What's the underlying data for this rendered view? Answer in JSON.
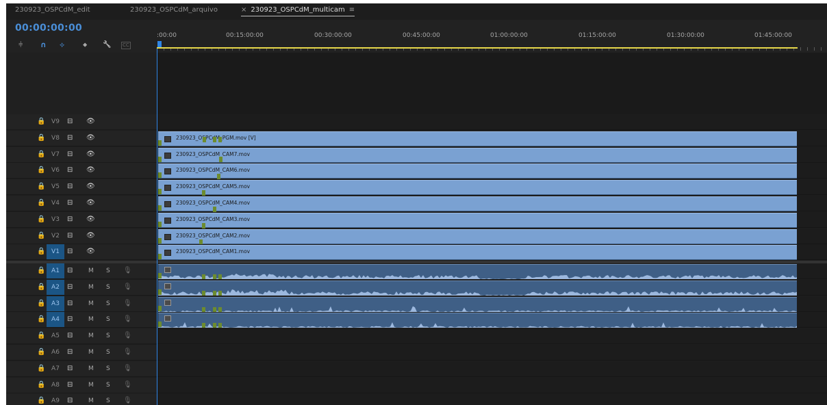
{
  "tabs": [
    {
      "label": "230923_OSPCdM_edit",
      "active": false
    },
    {
      "label": "230923_OSPCdM_arquivo",
      "active": false
    },
    {
      "label": "230923_OSPCdM_multicam",
      "active": true,
      "close_glyph": "×",
      "menu_glyph": "≡"
    }
  ],
  "timecode": "00:00:00:00",
  "tools": [
    {
      "name": "insert-nest-icon",
      "glyph": "⫩"
    },
    {
      "name": "snap-icon",
      "glyph": "∩"
    },
    {
      "name": "linked-selection-icon",
      "glyph": "⟡"
    },
    {
      "name": "add-marker-icon",
      "glyph": "⬥"
    },
    {
      "name": "wrench-icon",
      "glyph": "🔧"
    },
    {
      "name": "captions-icon",
      "glyph": "CC"
    }
  ],
  "ruler_ticks": [
    ":00:00",
    "00:15:00:00",
    "00:30:00:00",
    "00:45:00:00",
    "01:00:00:00",
    "01:15:00:00",
    "01:30:00:00",
    "01:45:00:00"
  ],
  "video_tracks": [
    "V9",
    "V8",
    "V7",
    "V6",
    "V5",
    "V4",
    "V3",
    "V2",
    "V1"
  ],
  "audio_tracks": [
    "A1",
    "A2",
    "A3",
    "A4",
    "A5",
    "A6",
    "A7",
    "A8",
    "A9"
  ],
  "targeted_tracks": [
    "V1",
    "A1",
    "A2",
    "A3",
    "A4"
  ],
  "track_controls": {
    "lock": "🔒",
    "sync": "⊟",
    "eye": "👁",
    "mute": "M",
    "solo": "S",
    "mic": "🎙"
  },
  "video_clips": [
    {
      "track": "V8",
      "label": "230923_OSPCdM_PGM.mov [V]"
    },
    {
      "track": "V7",
      "label": "230923_OSPCdM_CAM7.mov"
    },
    {
      "track": "V6",
      "label": "230923_OSPCdM_CAM6.mov"
    },
    {
      "track": "V5",
      "label": "230923_OSPCdM_CAM5.mov"
    },
    {
      "track": "V4",
      "label": "230923_OSPCdM_CAM4.mov"
    },
    {
      "track": "V3",
      "label": "230923_OSPCdM_CAM3.mov"
    },
    {
      "track": "V2",
      "label": "230923_OSPCdM_CAM2.mov"
    },
    {
      "track": "V1",
      "label": "230923_OSPCdM_CAM1.mov"
    }
  ],
  "audio_clips": [
    "A1",
    "A2",
    "A3",
    "A4"
  ],
  "colors": {
    "accent": "#2f86e6",
    "video_clip": "#7aa1d2",
    "audio_clip": "#3f5f86",
    "waveform": "#9cb8de",
    "marker": "#6d8c2f",
    "work_area": "#e7d84a",
    "target": "#1b5585"
  }
}
